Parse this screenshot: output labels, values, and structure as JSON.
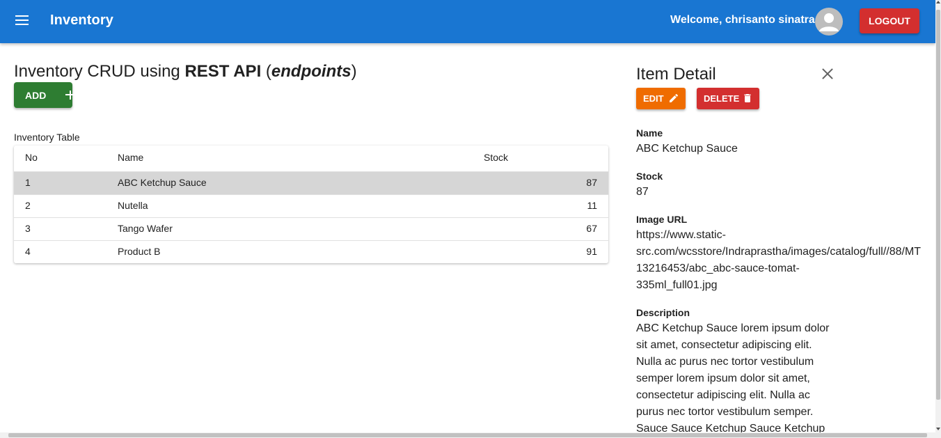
{
  "appbar": {
    "menu_icon": "hamburger-menu-icon",
    "title": "Inventory",
    "welcome": "Welcome, chrisanto sinatra",
    "avatar_icon": "person-avatar-icon",
    "logout_label": "LOGOUT",
    "color": "#1976d2"
  },
  "main": {
    "heading_prefix": "Inventory CRUD using ",
    "heading_bold": "REST API",
    "heading_paren_open": " (",
    "heading_italic": "endpoints",
    "heading_paren_close": ")",
    "add_label": "ADD",
    "add_icon": "plus-icon",
    "table_caption": "Inventory Table",
    "columns": [
      "No",
      "Name",
      "Stock"
    ],
    "rows": [
      {
        "no": "1",
        "name": "ABC Ketchup Sauce",
        "stock": "87",
        "selected": true
      },
      {
        "no": "2",
        "name": "Nutella",
        "stock": "11",
        "selected": false
      },
      {
        "no": "3",
        "name": "Tango Wafer",
        "stock": "67",
        "selected": false
      },
      {
        "no": "4",
        "name": "Product B",
        "stock": "91",
        "selected": false
      }
    ]
  },
  "detail": {
    "title": "Item Detail",
    "close_icon": "close-icon",
    "edit_label": "EDIT",
    "edit_icon": "pencil-icon",
    "delete_label": "DELETE",
    "delete_icon": "trash-icon",
    "name_label": "Name",
    "name_value": "ABC Ketchup Sauce",
    "stock_label": "Stock",
    "stock_value": "87",
    "image_label": "Image URL",
    "image_value": "https://www.static-\nsrc.com/wcsstore/Indraprastha/images/catalog/full//88/MT\n13216453/abc_abc-sauce-tomat-\n335ml_full01.jpg",
    "description_label": "Description",
    "description_value": "ABC Ketchup Sauce lorem ipsum dolor sit amet, consectetur adipiscing elit. Nulla ac purus nec tortor vestibulum semper lorem ipsum dolor sit amet, consectetur adipiscing elit. Nulla ac purus nec tortor vestibulum semper. Sauce Sauce Ketchup Sauce Ketchup"
  },
  "colors": {
    "add": "#2e7d32",
    "edit": "#ef6c00",
    "delete": "#d32f2f",
    "selected_row": "#d6d6d6"
  }
}
